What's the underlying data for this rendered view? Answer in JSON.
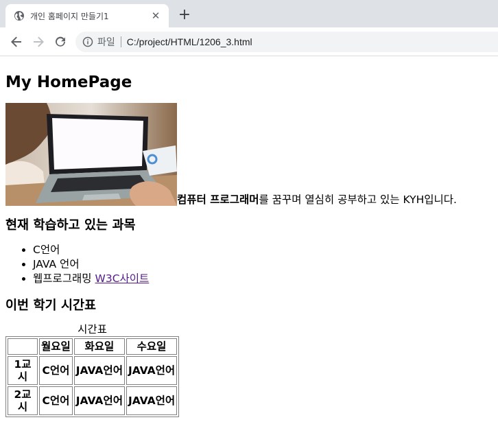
{
  "browser": {
    "tab_title": "개인 홈페이지 만들기1",
    "tab_close": "✕",
    "new_tab": "+",
    "address_scheme": "파일",
    "address_url": "C:/project/HTML/1206_3.html"
  },
  "page": {
    "title": "My HomePage",
    "intro_bold": "컴퓨터 프로그래머",
    "intro_rest": "를 꿈꾸며 열심히 공부하고 있는 KYH입니다.",
    "subjects_heading": "현재 학습하고 있는 과목",
    "subjects": [
      {
        "label": "C언어"
      },
      {
        "label": "JAVA 언어"
      },
      {
        "label": "웹프로그래밍 ",
        "link": "W3C사이트"
      }
    ],
    "timetable_heading": "이번 학기 시간표",
    "timetable": {
      "caption": "시간표",
      "headers": [
        "",
        "월요일",
        "화요일",
        "수요일"
      ],
      "rows": [
        [
          "1교시",
          "C언어",
          "JAVA언어",
          "JAVA언어"
        ],
        [
          "2교시",
          "C언어",
          "JAVA언어",
          "JAVA언어"
        ]
      ]
    }
  }
}
